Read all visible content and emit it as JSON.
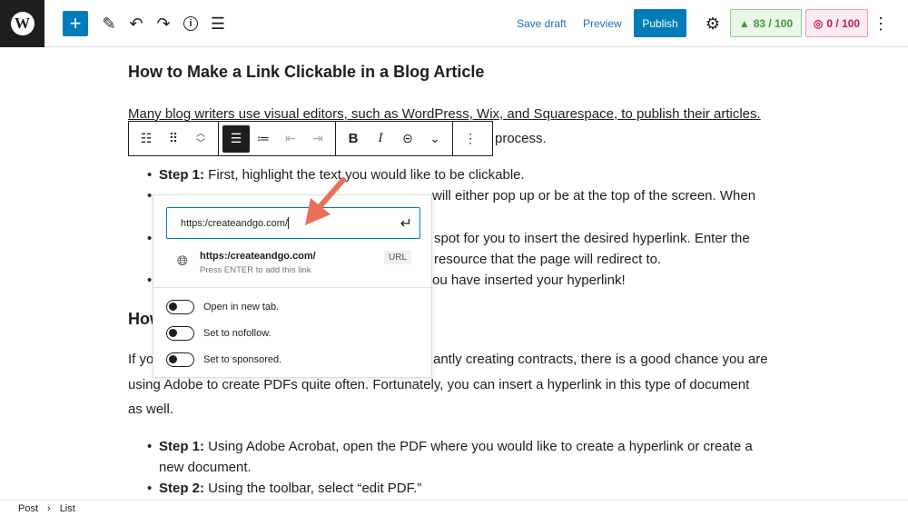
{
  "topbar": {
    "logo": "W",
    "add_icon": "plus-icon",
    "save_draft": "Save draft",
    "preview": "Preview",
    "publish": "Publish",
    "seo_score": "83 / 100",
    "readability_score": "0 / 100",
    "seo_color": "#3b9b35",
    "readability_color": "#c2185b",
    "accent": "#007cba"
  },
  "article": {
    "title": "How to Make a Link Clickable in a Blog Article",
    "p1_line1": "Many blog writers use visual editors, such as WordPress, Wix, and Squarespace, to publish their articles.",
    "p1_line2_visible": "process.",
    "step1_label": "Step 1:",
    "step1_text": " First, highlight the text you would like to be clickable.",
    "step2_visible": "will either pop up or be at the top of the screen. When",
    "step3_line1_visible": "spot for you to insert the desired hyperlink. Enter the",
    "step3_line2_visible": "resource that the page will redirect to.",
    "step4_visible": "ou have inserted your hyperlink!",
    "h2_visible": "How",
    "p2_line1_start": "If yo",
    "p2_line1_end": "antly creating contracts, there is a good chance you are",
    "p2_line2": "using Adobe to create PDFs quite often. Fortunately, you can insert a hyperlink in this type of document",
    "p2_line3": "as well.",
    "b1_label": "Step 1:",
    "b1_text": " Using Adobe Acrobat, open the PDF where you would like to create a hyperlink or create a",
    "b1_line2": "new document.",
    "b2_label": "Step 2:",
    "b2_text": " Using the toolbar, select “edit PDF.”"
  },
  "block_toolbar": {
    "bold": "B",
    "italic": "I"
  },
  "link_popover": {
    "url_value": "https:/createandgo.com/",
    "suggestion_title": "https:/createandgo.com/",
    "suggestion_hint": "Press ENTER to add this link",
    "suggestion_type": "URL",
    "toggles": [
      {
        "label": "Open in new tab.",
        "on": false
      },
      {
        "label": "Set to nofollow.",
        "on": false
      },
      {
        "label": "Set to sponsored.",
        "on": false
      }
    ],
    "arrow_color": "#e8705a"
  },
  "breadcrumb": {
    "items": [
      "Post",
      "List"
    ],
    "separator": "›"
  }
}
